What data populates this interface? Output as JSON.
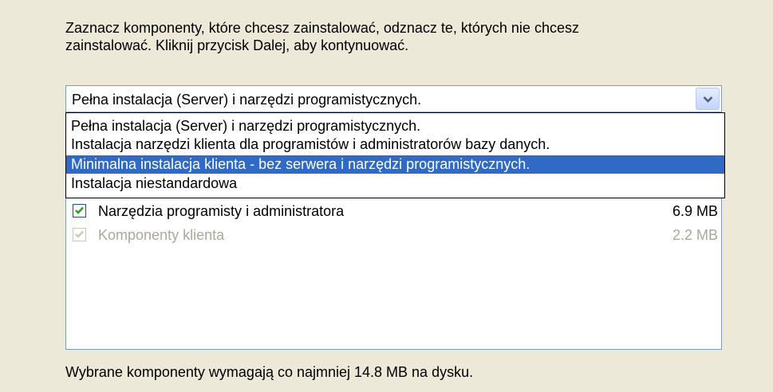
{
  "instructions": {
    "line1": "Zaznacz komponenty, które chcesz zainstalować, odznacz te, których nie chcesz",
    "line2": "zainstalować. Kliknij przycisk Dalej, aby kontynuować."
  },
  "install_type": {
    "selected_value": "Pełna instalacja (Server) i narzędzi programistycznych.",
    "options": [
      "Pełna instalacja (Server) i narzędzi programistycznych.",
      "Instalacja narzędzi klienta dla programistów i administratorów bazy danych.",
      "Minimalna instalacja klienta - bez serwera i narzędzi programistycznych.",
      "Instalacja niestandardowa"
    ],
    "highlighted_option": "Minimalna instalacja klienta - bez serwera i narzędzi programistycznych."
  },
  "components": [
    {
      "label": "Narzędzia programisty i administratora",
      "size": "6.9 MB",
      "checked": true,
      "enabled": true
    },
    {
      "label": "Komponenty klienta",
      "size": "2.2 MB",
      "checked": true,
      "enabled": false
    }
  ],
  "footer": {
    "space_required": "Wybrane komponenty wymagają co najmniej 14.8 MB na dysku."
  },
  "colors": {
    "dialog_bg": "#ece9d8",
    "selection_bg": "#316ac5",
    "checkmark": "#21a121",
    "disabled_text": "#aca899"
  },
  "icons": {
    "dropdown": "chevron-down-icon",
    "checkbox": "checkmark-icon"
  }
}
